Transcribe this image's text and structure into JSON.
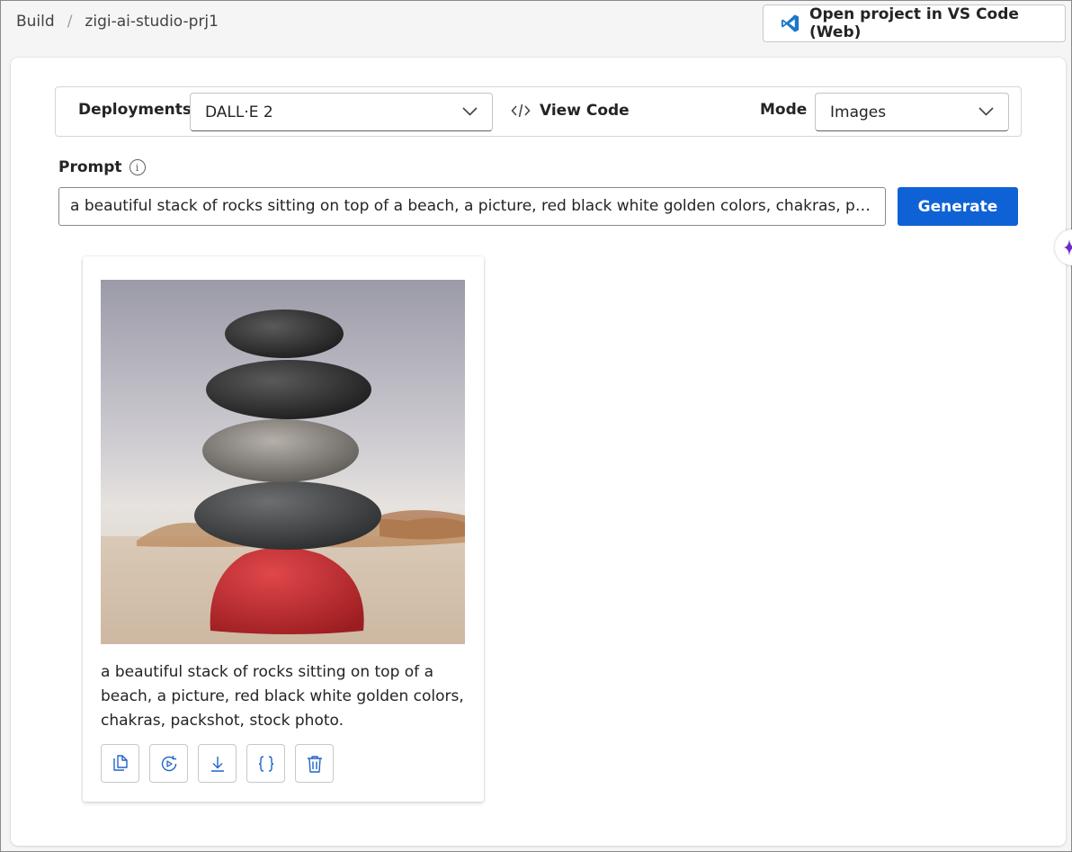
{
  "breadcrumb": {
    "root": "Build",
    "separator": "/",
    "project": "zigi-ai-studio-prj1"
  },
  "header": {
    "vscode_button": "Open project in VS Code (Web)"
  },
  "toolbar": {
    "deployments_label": "Deployments",
    "deployment_value": "DALL·E 2",
    "view_code_label": "View Code",
    "mode_label": "Mode",
    "mode_value": "Images"
  },
  "prompt": {
    "label": "Prompt",
    "value": "a beautiful stack of rocks sitting on top of a beach, a picture, red black white golden colors, chakras, packshot, stock photo.",
    "generate_label": "Generate"
  },
  "result": {
    "caption": "a beautiful stack of rocks sitting on top of a beach, a picture, red black white golden colors, chakras, packshot, stock photo.",
    "actions": [
      "copy-icon",
      "play-regenerate-icon",
      "download-icon",
      "json-icon",
      "delete-icon"
    ]
  },
  "colors": {
    "accent": "#0f62d6",
    "icon_blue": "#2364c8",
    "copilot_purple": "#6b2cc7"
  }
}
